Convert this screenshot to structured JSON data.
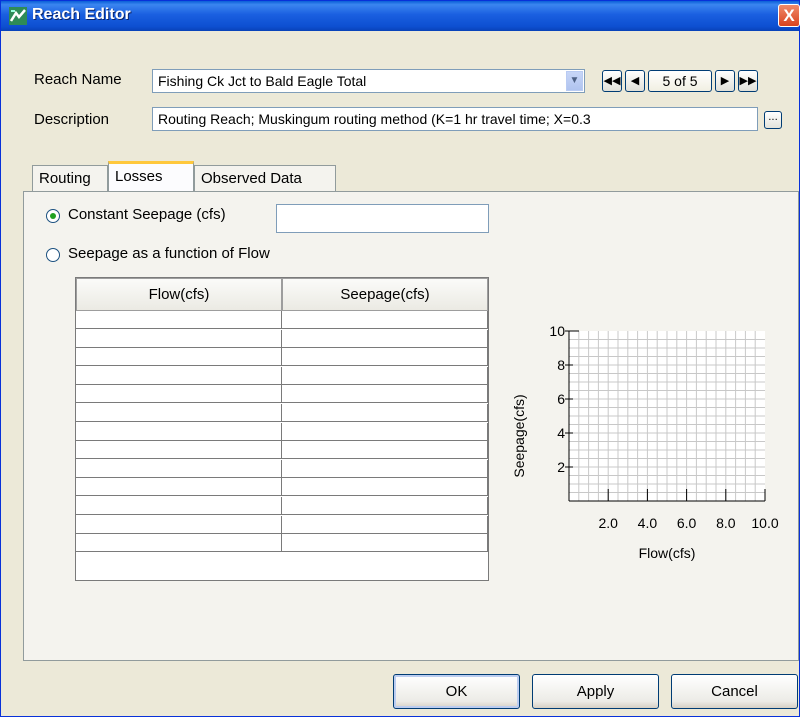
{
  "window": {
    "title": "Reach Editor",
    "close_glyph": "X"
  },
  "reach_name": {
    "label": "Reach Name",
    "value": "Fishing Ck Jct to Bald Eagle Total",
    "nav_count": "5 of 5"
  },
  "description": {
    "label": "Description",
    "value": "Routing Reach; Muskingum routing method (K=1 hr travel time; X=0.3",
    "browse_label": "..."
  },
  "tabs": [
    {
      "label": "Routing"
    },
    {
      "label": "Losses",
      "active": true
    },
    {
      "label": "Observed Data"
    }
  ],
  "losses": {
    "constant_label": "Constant Seepage (cfs)",
    "constant_value": "",
    "constant_selected": true,
    "function_label": "Seepage as a function of Flow",
    "table": {
      "columns": [
        "Flow(cfs)",
        "Seepage(cfs)"
      ],
      "rows": [
        [
          "",
          ""
        ],
        [
          "",
          ""
        ],
        [
          "",
          ""
        ],
        [
          "",
          ""
        ],
        [
          "",
          ""
        ],
        [
          "",
          ""
        ],
        [
          "",
          ""
        ],
        [
          "",
          ""
        ],
        [
          "",
          ""
        ],
        [
          "",
          ""
        ],
        [
          "",
          ""
        ],
        [
          "",
          ""
        ],
        [
          "",
          ""
        ]
      ]
    }
  },
  "chart_data": {
    "type": "line",
    "series": [],
    "xlabel": "Flow(cfs)",
    "ylabel": "Seepage(cfs)",
    "xticks": [
      "2.0",
      "4.0",
      "6.0",
      "8.0",
      "10.0"
    ],
    "yticks": [
      "2",
      "4",
      "6",
      "8",
      "10"
    ],
    "xlim": [
      0,
      10
    ],
    "ylim": [
      0,
      10
    ],
    "grid": true
  },
  "buttons": {
    "ok": "OK",
    "apply": "Apply",
    "cancel": "Cancel"
  },
  "colors": {
    "title_bar": "#0d4fd1",
    "tab_highlight": "#ffc83c",
    "radio_dot": "#21a121"
  }
}
